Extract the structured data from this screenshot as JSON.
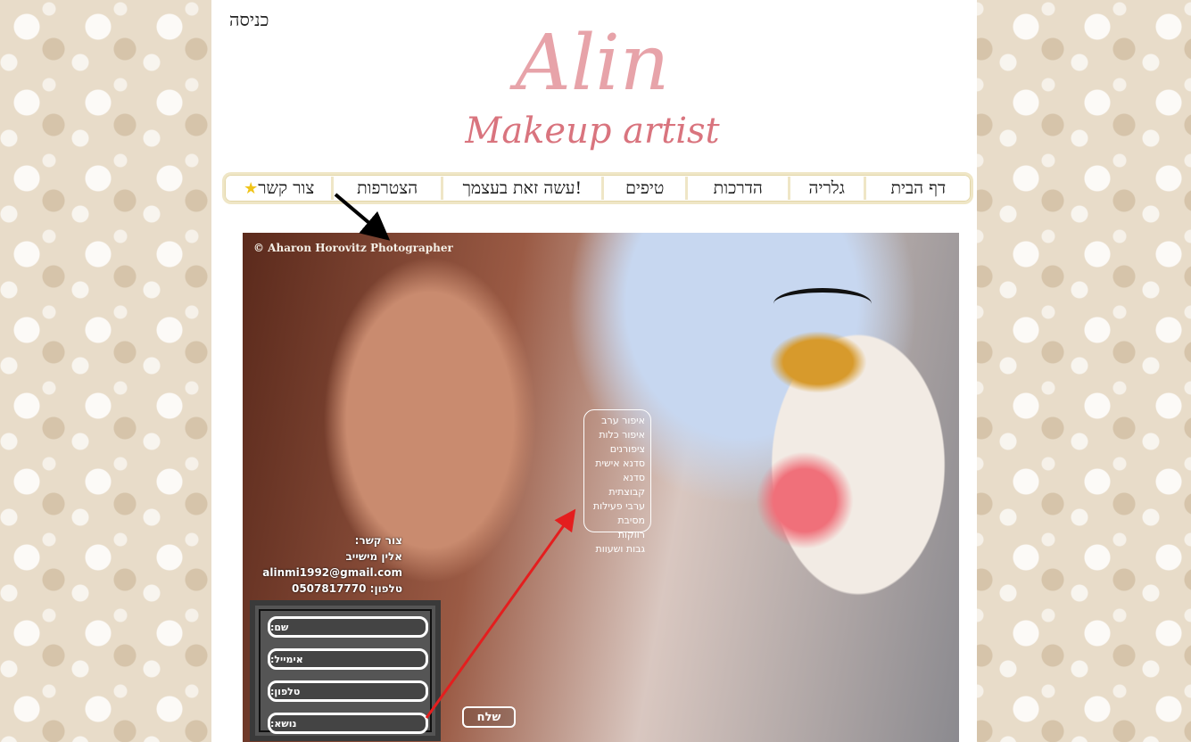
{
  "header": {
    "login_label": "כניסה",
    "logo_main": "Alin",
    "logo_sub": "Makeup artist"
  },
  "nav": {
    "items": [
      "דף הבית",
      "גלריה",
      "הדרכות",
      "טיפים",
      "עשה זאת בעצמך!",
      "הצטרפות",
      "צור קשר"
    ]
  },
  "photo": {
    "credit": "© Aharon Horovitz Photographer"
  },
  "services": {
    "items": [
      "איפור ערב",
      "איפור כלות",
      "ציפורנים",
      "סדנא אישית",
      "סדנא קבוצתית",
      "ערבי פעילות",
      "מסיבת רווקות",
      "גבות ושעוות"
    ]
  },
  "contact": {
    "title": "צור קשר:",
    "name": "אלין מישייב",
    "email": "alinmi1992@gmail.com",
    "phone_line": "טלפון: 0507817770"
  },
  "form": {
    "fields": [
      "שם:",
      "אימייל:",
      "טלפון:",
      "נושא:"
    ],
    "send_label": "שלח"
  },
  "colors": {
    "logo_pink": "#e7a3a9",
    "logo_sub": "#d9747e",
    "nav_border": "#efe6c6",
    "star": "#f0c419",
    "arrow_red": "#e41e1e"
  }
}
